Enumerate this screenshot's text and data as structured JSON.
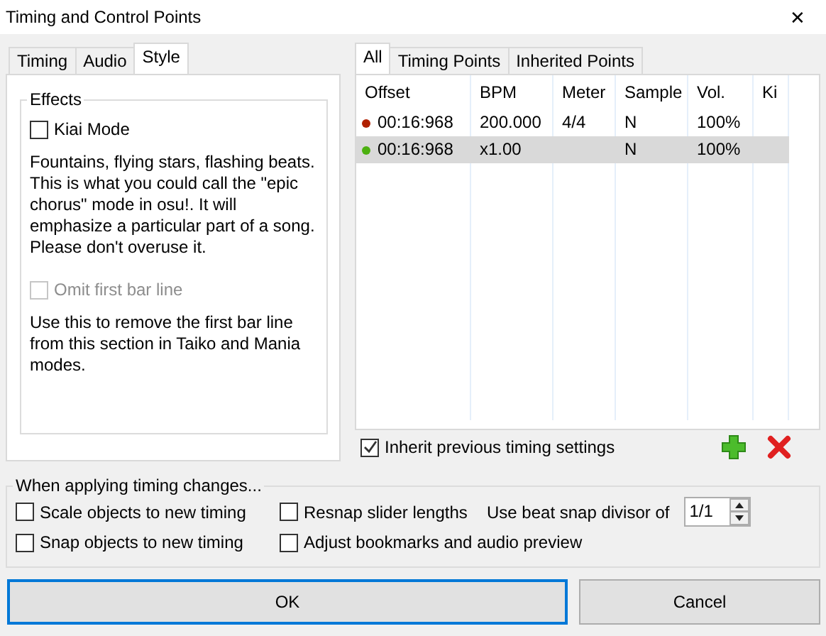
{
  "window": {
    "title": "Timing and Control Points",
    "close": "✕"
  },
  "left_tabs": [
    {
      "label": "Timing",
      "selected": false
    },
    {
      "label": "Audio",
      "selected": false
    },
    {
      "label": "Style",
      "selected": true
    }
  ],
  "effects": {
    "title": "Effects",
    "options": [
      {
        "label": "Kiai Mode",
        "checked": false,
        "disabled": false,
        "description": "Fountains, flying stars, flashing beats. This is what you could call the \"epic chorus\" mode in osu!. It will emphasize a particular part of a song. Please don't overuse it."
      },
      {
        "label": "Omit first bar line",
        "checked": false,
        "disabled": true,
        "description": "Use this to remove the first bar line from this section in Taiko and Mania modes."
      }
    ]
  },
  "right_tabs": [
    {
      "label": "All",
      "selected": true
    },
    {
      "label": "Timing Points",
      "selected": false
    },
    {
      "label": "Inherited Points",
      "selected": false
    }
  ],
  "table": {
    "columns": [
      "Offset",
      "BPM",
      "Meter",
      "Sample",
      "Vol.",
      "Ki"
    ],
    "rows": [
      {
        "color": "#b02000",
        "selected": false,
        "cells": [
          "00:16:968",
          "200.000",
          "4/4",
          "N",
          "100%",
          ""
        ]
      },
      {
        "color": "#4cb010",
        "selected": true,
        "cells": [
          "00:16:968",
          "x1.00",
          "",
          "N",
          "100%",
          ""
        ]
      }
    ]
  },
  "inherit": {
    "label": "Inherit previous timing settings",
    "checked": true
  },
  "changes": {
    "title": "When applying timing changes...",
    "options": [
      {
        "label": "Scale objects to new timing",
        "checked": false
      },
      {
        "label": "Resnap slider lengths",
        "checked": false
      },
      {
        "label": "Snap objects to new timing",
        "checked": false
      },
      {
        "label": "Adjust bookmarks and audio preview",
        "checked": false
      }
    ],
    "divisor_label": "Use beat snap divisor of",
    "divisor_value": "1/1"
  },
  "buttons": [
    {
      "label": "OK",
      "focused": true
    },
    {
      "label": "Cancel",
      "focused": false
    }
  ]
}
